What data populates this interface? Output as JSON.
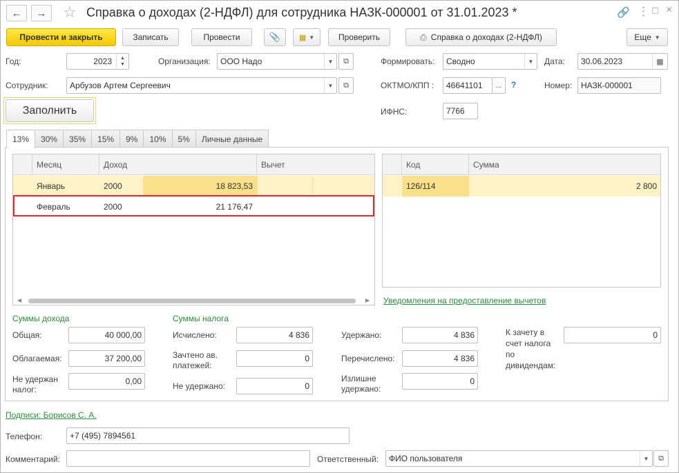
{
  "window": {
    "title": "Справка о доходах (2-НДФЛ) для сотрудника НАЗК-000001 от 31.01.2023 *"
  },
  "toolbar": {
    "post_close": "Провести и закрыть",
    "save": "Записать",
    "post": "Провести",
    "check": "Проверить",
    "print_report": "Справка о доходах (2-НДФЛ)",
    "more": "Еще"
  },
  "header": {
    "year_label": "Год:",
    "year_value": "2023",
    "org_label": "Организация:",
    "org_value": "ООО Надо",
    "form_label": "Формировать:",
    "form_value": "Сводно",
    "date_label": "Дата:",
    "date_value": "30.06.2023",
    "employee_label": "Сотрудник:",
    "employee_value": "Арбузов Артем Сергеевич",
    "oktmo_label": "ОКТМО/КПП :",
    "oktmo_value": "46641101",
    "oktmo_help": "?",
    "number_label": "Номер:",
    "number_value": "НАЗК-000001",
    "ifns_label": "ИФНС:",
    "ifns_value": "7766",
    "fill_button": "Заполнить"
  },
  "tabs": [
    "13%",
    "30%",
    "35%",
    "15%",
    "9%",
    "10%",
    "5%",
    "Личные данные"
  ],
  "income_table": {
    "columns": [
      "Месяц",
      "Доход",
      "Вычет"
    ],
    "rows": [
      {
        "month": "Январь",
        "code": "2000",
        "amount": "18 823,53"
      },
      {
        "month": "Февраль",
        "code": "2000",
        "amount": "21 176,47"
      }
    ]
  },
  "deductions_table": {
    "columns": [
      "Код",
      "Сумма"
    ],
    "rows": [
      {
        "code": "126/114",
        "sum": "2 800"
      }
    ]
  },
  "deduction_notices_link": "Уведомления на предоставление вычетов",
  "income_sums": {
    "title": "Суммы дохода",
    "total_label": "Общая:",
    "total_value": "40 000,00",
    "taxable_label": "Облагаемая:",
    "taxable_value": "37 200,00",
    "not_withheld_label": "Не удержан налог:",
    "not_withheld_value": "0,00"
  },
  "tax_sums": {
    "title": "Суммы налога",
    "calculated_label": "Исчислено:",
    "calculated_value": "4 836",
    "advance_label": "Зачтено ав. платежей:",
    "advance_value": "0",
    "not_withheld_label": "Не удержано:",
    "not_withheld_value": "0",
    "withheld_label": "Удержано:",
    "withheld_value": "4 836",
    "transferred_label": "Перечислено:",
    "transferred_value": "4 836",
    "overwithheld_label": "Излишне удержано:",
    "overwithheld_value": "0",
    "dividend_label": "К зачету в счет налога по дивидендам:",
    "dividend_value": "0"
  },
  "footer": {
    "signatures_link": "Подписи: Борисов С. А.",
    "phone_label": "Телефон:",
    "phone_value": "+7 (495) 7894561",
    "comment_label": "Комментарий:",
    "comment_value": "",
    "responsible_label": "Ответственный:",
    "responsible_value": "ФИО пользователя"
  },
  "colors": {
    "primary_button": "#f5c900",
    "link_green": "#2e8b3a",
    "selected_row": "#fdf3c6",
    "highlight_cell": "#fbe08c",
    "red_frame": "#d9262b"
  }
}
